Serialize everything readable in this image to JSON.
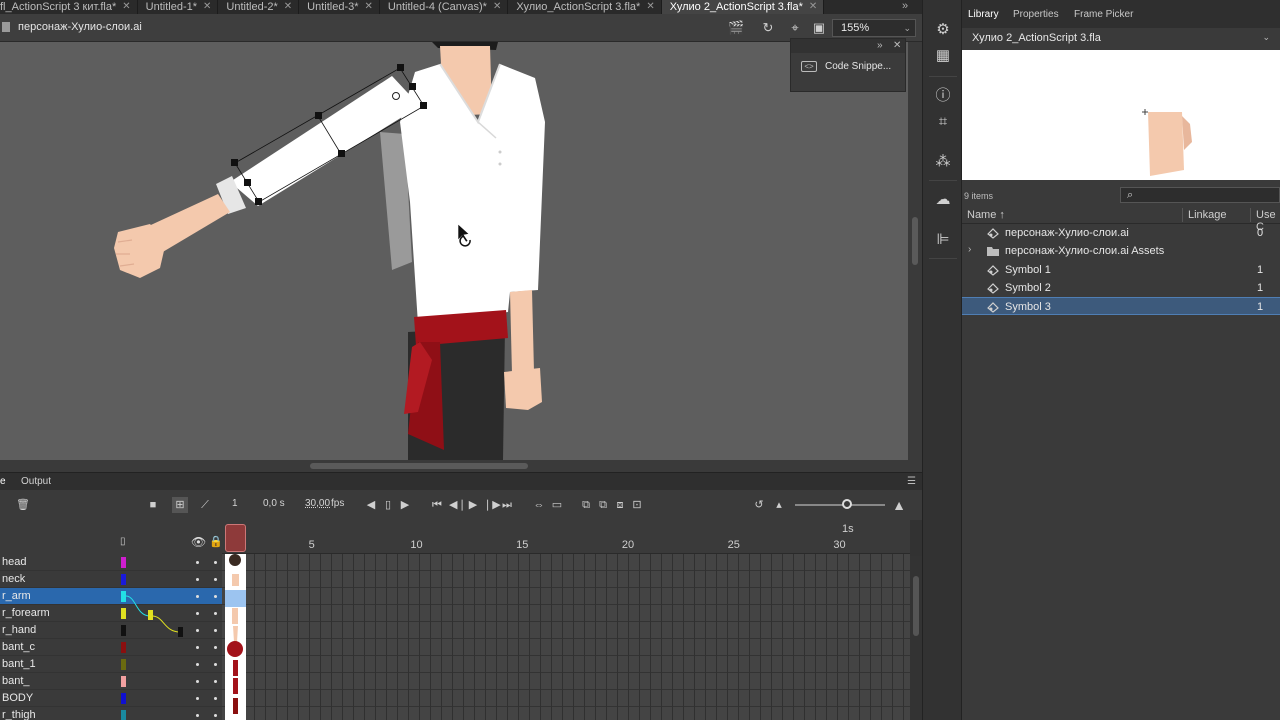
{
  "tabs": [
    {
      "label": "fl_ActionScript 3 кит.fla*",
      "active": false
    },
    {
      "label": "Untitled-1*",
      "active": false
    },
    {
      "label": "Untitled-2*",
      "active": false
    },
    {
      "label": "Untitled-3*",
      "active": false
    },
    {
      "label": "Untitled-4 (Canvas)*",
      "active": false
    },
    {
      "label": "Хулио_ActionScript 3.fla*",
      "active": false
    },
    {
      "label": "Хулио 2_ActionScript 3.fla*",
      "active": true
    }
  ],
  "tab_close": "✕",
  "tab_more": "»",
  "editbar": {
    "scene_name": "персонаж-Хулио-слои.ai",
    "zoom": "155%",
    "zoom_arrow": "⌄"
  },
  "code_snippets": {
    "label": "Code Snippe...",
    "collapse": "»",
    "close": "✕"
  },
  "timeline": {
    "tab_timeline": "e",
    "tab_output": "Output",
    "menu": "☰",
    "current_frame": "1",
    "time": "0,0 s",
    "fps": "30,00",
    "fps_unit": "fps",
    "ruler_numbers": [
      "5",
      "10",
      "15",
      "20",
      "25",
      "30"
    ],
    "ruler_second": "1s",
    "layers": [
      {
        "name": "head",
        "color": "#d01ed0",
        "selected": false
      },
      {
        "name": "neck",
        "color": "#1a1ad9",
        "selected": false
      },
      {
        "name": "r_arm",
        "color": "#22e0e6",
        "selected": true
      },
      {
        "name": "r_forearm",
        "color": "#e0e020",
        "selected": false
      },
      {
        "name": "r_hand",
        "color": "#111111",
        "selected": false
      },
      {
        "name": "bant_c",
        "color": "#8a0f0f",
        "selected": false
      },
      {
        "name": "bant_1",
        "color": "#6a6a10",
        "selected": false
      },
      {
        "name": "bant_",
        "color": "#f2a0a0",
        "selected": false
      },
      {
        "name": "BODY",
        "color": "#1010d0",
        "selected": false
      },
      {
        "name": "r_thigh",
        "color": "#1a8aa0",
        "selected": false
      }
    ]
  },
  "library": {
    "tabs": [
      "Library",
      "Properties",
      "Frame Picker"
    ],
    "active_tab": "Library",
    "document": "Хулио 2_ActionScript 3.fla",
    "item_count": "9 items",
    "col_name": "Name",
    "col_linkage": "Linkage",
    "col_use": "Use C",
    "items": [
      {
        "name": "персонаж-Хулио-слои.ai",
        "use": "0",
        "type": "symbol",
        "selected": false,
        "expandable": false
      },
      {
        "name": "персонаж-Хулио-слои.ai Assets",
        "use": "",
        "type": "folder",
        "selected": false,
        "expandable": true
      },
      {
        "name": "Symbol 1",
        "use": "1",
        "type": "symbol",
        "selected": false,
        "expandable": false
      },
      {
        "name": "Symbol 2",
        "use": "1",
        "type": "symbol",
        "selected": false,
        "expandable": false
      },
      {
        "name": "Symbol 3",
        "use": "1",
        "type": "symbol",
        "selected": true,
        "expandable": false
      }
    ]
  },
  "colors": {
    "accent": "#2a68ad",
    "stage_bg": "#5e5e5e",
    "sash": "#a3121a",
    "skin": "#f4c9ad",
    "shirt": "#ffffff"
  }
}
